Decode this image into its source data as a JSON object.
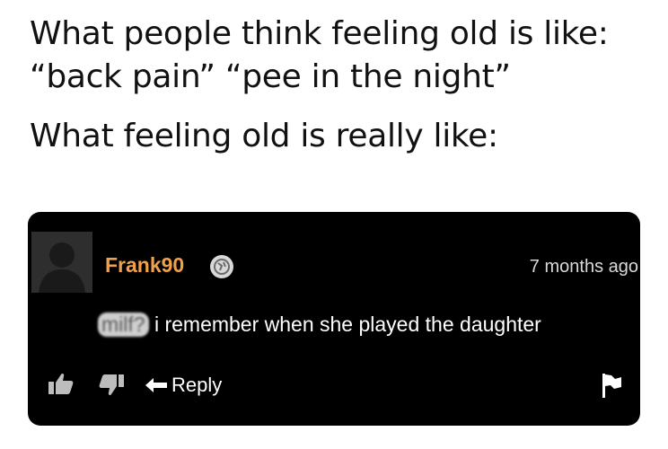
{
  "caption": {
    "line1": "What people think feeling old is like:",
    "line2": "“back pain” “pee in the night”",
    "line3": "What feeling old is really like:"
  },
  "comment": {
    "username": "Frank90",
    "timestamp": "7 months ago",
    "blurred_word": "milf?",
    "text": " i remember when she played the daughter",
    "reply_label": "Reply",
    "icons": {
      "avatar": "default-user-silhouette",
      "badge": "verified-globe-icon",
      "upvote": "thumb-up-icon",
      "downvote": "thumb-down-icon",
      "reply": "reply-arrow-icon",
      "report": "flag-icon"
    },
    "colors": {
      "card_background": "#000000",
      "username": "#f1a14a",
      "text": "#ffffff"
    }
  }
}
